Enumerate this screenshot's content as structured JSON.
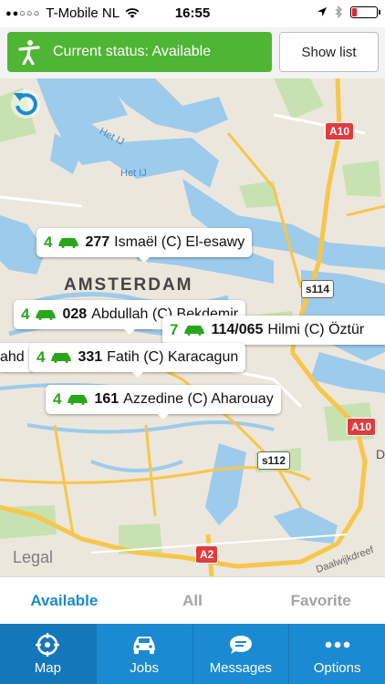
{
  "status_bar": {
    "carrier": "T-Mobile NL",
    "time": "16:55"
  },
  "topbar": {
    "status_label": "Current status: Available",
    "show_list_label": "Show list"
  },
  "map": {
    "city_label": "AMSTERDAM",
    "water_labels": [
      "Het IJ",
      "Het IJ"
    ],
    "road_shields": [
      "A10",
      "s114",
      "A10",
      "s112",
      "A2"
    ],
    "street_label": "Daalwijkdreef",
    "legal": "Legal",
    "markers": [
      {
        "count": "4",
        "number": "277",
        "name": "Ismaël (C) El-esawy"
      },
      {
        "count": "4",
        "number": "028",
        "name": "Abdullah (C) Bekdemir"
      },
      {
        "count": "7",
        "number": "114/065",
        "name": "Hilmi (C) Öztür"
      },
      {
        "count": "4",
        "number": "331",
        "name": "Fatih (C) Karacagun"
      },
      {
        "count": "4",
        "number": "161",
        "name": "Azzedine (C) Aharouay"
      }
    ],
    "partial_marker_text": "ahd (",
    "partial_letter": "D"
  },
  "segments": [
    "Available",
    "All",
    "Favorite"
  ],
  "tabs": [
    {
      "label": "Map",
      "icon": "compass-icon"
    },
    {
      "label": "Jobs",
      "icon": "car-icon"
    },
    {
      "label": "Messages",
      "icon": "chat-bubble-icon"
    },
    {
      "label": "Options",
      "icon": "more-dots-icon"
    }
  ],
  "colors": {
    "accent": "#1b8ad2",
    "status_green": "#4fb534",
    "count_green": "#2aa61d",
    "water": "#9dcbeb",
    "park": "#c7e2b0",
    "highway": "#f7c64a"
  }
}
